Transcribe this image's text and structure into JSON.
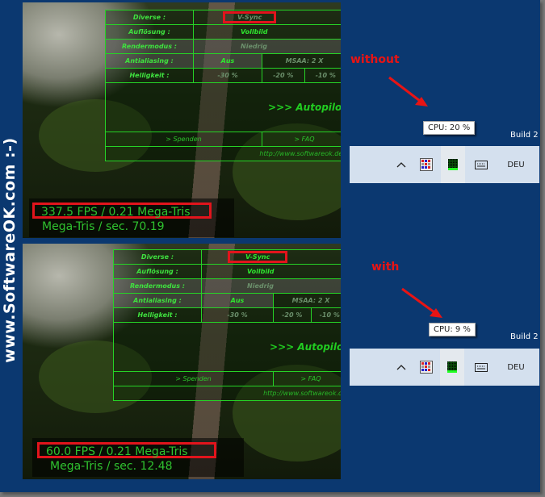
{
  "watermark": "www.SoftwareOK.com :-)",
  "panels": [
    {
      "id": "without",
      "annotation": "without",
      "menu": {
        "rows": [
          {
            "label": "Diverse :",
            "cells": [
              "V-Sync"
            ]
          },
          {
            "label": "Auflösung :",
            "cells": [
              "Vollbild"
            ]
          },
          {
            "label": "Rendermodus :",
            "cells": [
              "Niedrig"
            ]
          },
          {
            "label": "Antialiasing :",
            "cells": [
              "Aus",
              "MSAA: 2 X"
            ]
          },
          {
            "label": "Helligkeit :",
            "cells": [
              "-30 %",
              "-20 %",
              "-10 %"
            ]
          }
        ],
        "autopilot": ">>> Autopilot",
        "links": [
          "> Spenden",
          "> FAQ"
        ],
        "url": "http://www.softwareok.de/",
        "vsync_active": false
      },
      "stats": {
        "fps_line": "337.5 FPS / 0.21 Mega-Tris",
        "tris_line": "Mega-Tris / sec. 70.19"
      },
      "cpu_tooltip": "CPU: 20 %",
      "build_label": "Build 2",
      "tray": {
        "language": "DEU",
        "icons": [
          "chevron-up-icon",
          "app-grid-icon",
          "cpu-meter-icon",
          "keyboard-icon"
        ]
      }
    },
    {
      "id": "with",
      "annotation": "with",
      "menu": {
        "rows": [
          {
            "label": "Diverse :",
            "cells": [
              "V-Sync"
            ]
          },
          {
            "label": "Auflösung :",
            "cells": [
              "Vollbild"
            ]
          },
          {
            "label": "Rendermodus :",
            "cells": [
              "Niedrig"
            ]
          },
          {
            "label": "Antialiasing :",
            "cells": [
              "Aus",
              "MSAA: 2 X"
            ]
          },
          {
            "label": "Helligkeit :",
            "cells": [
              "-30 %",
              "-20 %",
              "-10 %"
            ]
          }
        ],
        "autopilot": ">>> Autopilot",
        "links": [
          "> Spenden",
          "> FAQ"
        ],
        "url": "http://www.softwareok.de",
        "vsync_active": true
      },
      "stats": {
        "fps_line": "60.0 FPS / 0.21 Mega-Tris",
        "tris_line": "Mega-Tris / sec. 12.48"
      },
      "cpu_tooltip": "CPU: 9 %",
      "build_label": "Build 2",
      "tray": {
        "language": "DEU",
        "icons": [
          "chevron-up-icon",
          "app-grid-icon",
          "cpu-meter-icon",
          "keyboard-icon"
        ]
      }
    }
  ],
  "colors": {
    "background": "#0b3870",
    "menu_green": "#2ee62e",
    "highlight_red": "#e2141c",
    "annotation_red": "#e81414",
    "taskbar": "#d4e0ee"
  }
}
